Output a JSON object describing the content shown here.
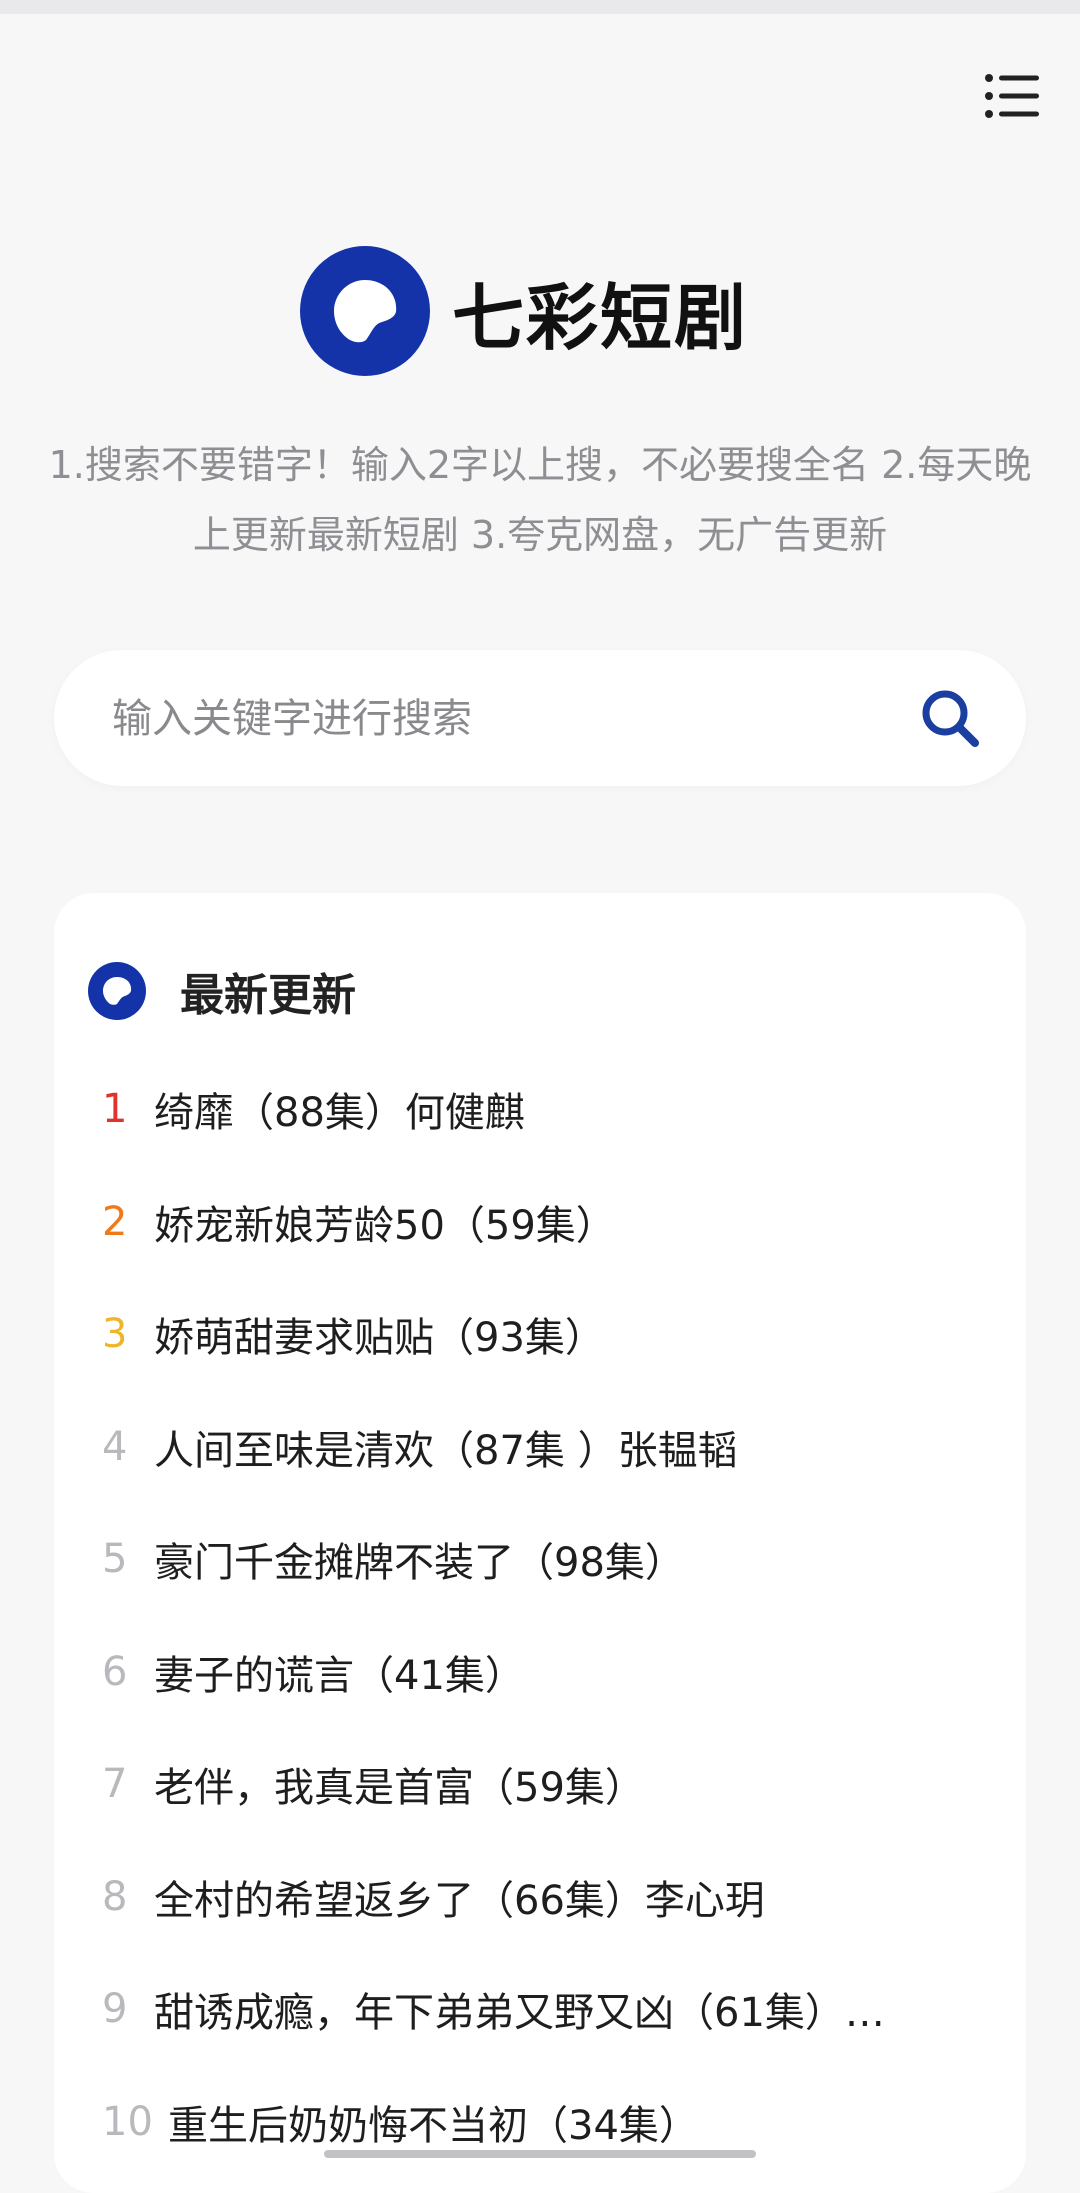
{
  "app": {
    "name": "七彩短剧",
    "notice": "1.搜索不要错字！输入2字以上搜，不必要搜全名 2.每天晚上更新最新短剧 3.夸克网盘，无广告更新"
  },
  "header": {
    "menu_icon": "menu-icon"
  },
  "search": {
    "placeholder": "输入关键字进行搜索",
    "value": "",
    "icon": "search-icon"
  },
  "latest": {
    "title": "最新更新",
    "items": [
      {
        "rank": "1",
        "title": "绮靡（88集）何健麒",
        "rank_color": "#e0342b"
      },
      {
        "rank": "2",
        "title": "娇宠新娘芳龄50（59集）",
        "rank_color": "#f07a1a"
      },
      {
        "rank": "3",
        "title": "娇萌甜妻求贴贴（93集）",
        "rank_color": "#f0b428"
      },
      {
        "rank": "4",
        "title": "人间至味是清欢（87集 ）张韫韬"
      },
      {
        "rank": "5",
        "title": "豪门千金摊牌不装了（98集）"
      },
      {
        "rank": "6",
        "title": "妻子的谎言（41集）"
      },
      {
        "rank": "7",
        "title": "老伴，我真是首富（59集）"
      },
      {
        "rank": "8",
        "title": "全村的希望返乡了（66集）李心玥"
      },
      {
        "rank": "9",
        "title": "甜诱成瘾，年下弟弟又野又凶（61集）…"
      },
      {
        "rank": "10",
        "title": "重生后奶奶悔不当初（34集）"
      }
    ]
  },
  "colors": {
    "brand": "#1433a8",
    "accent_icon": "#1a3fa0",
    "rank_default": "#b9b9bd"
  }
}
